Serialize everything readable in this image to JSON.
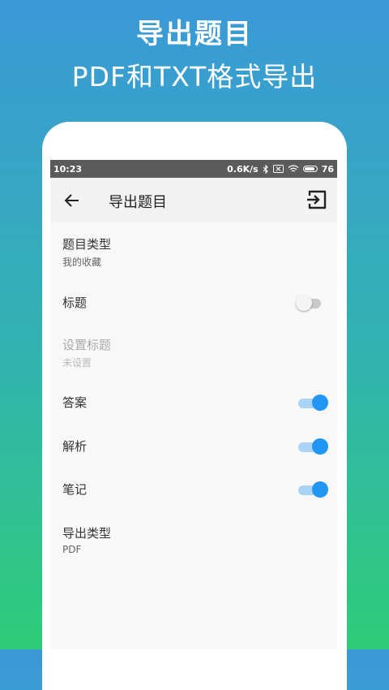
{
  "promo": {
    "title": "导出题目",
    "subtitle": "PDF和TXT格式导出"
  },
  "statusbar": {
    "time": "10:23",
    "speed": "0.6K/s",
    "battery": "76"
  },
  "toolbar": {
    "title": "导出题目",
    "back_icon": "arrow-left-icon",
    "export_icon": "exit-to-app-icon"
  },
  "settings": {
    "question_type": {
      "label": "题目类型",
      "value": "我的收藏"
    },
    "title_toggle": {
      "label": "标题",
      "on": false
    },
    "set_title": {
      "label": "设置标题",
      "value": "未设置",
      "disabled": true
    },
    "answer_toggle": {
      "label": "答案",
      "on": true
    },
    "analysis_toggle": {
      "label": "解析",
      "on": true
    },
    "notes_toggle": {
      "label": "笔记",
      "on": true
    },
    "export_type": {
      "label": "导出类型",
      "value": "PDF"
    }
  },
  "colors": {
    "accent": "#2196f3",
    "gradient_top": "#3a99d8",
    "gradient_bottom": "#2ecc78"
  }
}
